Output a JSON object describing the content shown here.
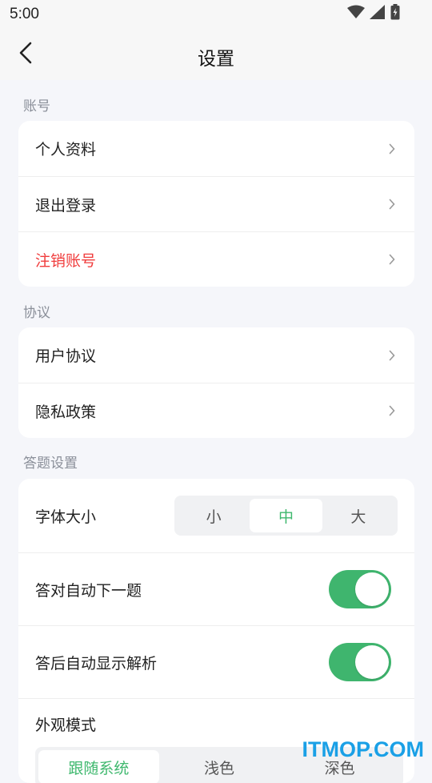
{
  "status_bar": {
    "time": "5:00",
    "icons": [
      "wifi-icon",
      "signal-icon",
      "battery-icon"
    ]
  },
  "nav": {
    "title": "设置",
    "back_icon": "chevron-left-icon"
  },
  "sections": {
    "account": {
      "title": "账号",
      "items": [
        {
          "label": "个人资料"
        },
        {
          "label": "退出登录"
        },
        {
          "label": "注销账号",
          "danger": true
        }
      ]
    },
    "agreement": {
      "title": "协议",
      "items": [
        {
          "label": "用户协议"
        },
        {
          "label": "隐私政策"
        }
      ]
    },
    "answer": {
      "title": "答题设置",
      "font_size": {
        "label": "字体大小",
        "options": [
          "小",
          "中",
          "大"
        ],
        "selected": "中"
      },
      "auto_next": {
        "label": "答对自动下一题",
        "on": true
      },
      "auto_analysis": {
        "label": "答后自动显示解析",
        "on": true
      },
      "appearance": {
        "label": "外观模式",
        "options": [
          "跟随系统",
          "浅色",
          "深色"
        ],
        "selected": "跟随系统"
      }
    }
  },
  "colors": {
    "accent": "#3fb56e",
    "danger": "#f03c3c",
    "watermark": "#1aa0e6"
  },
  "watermark": "ITMOP.COM"
}
